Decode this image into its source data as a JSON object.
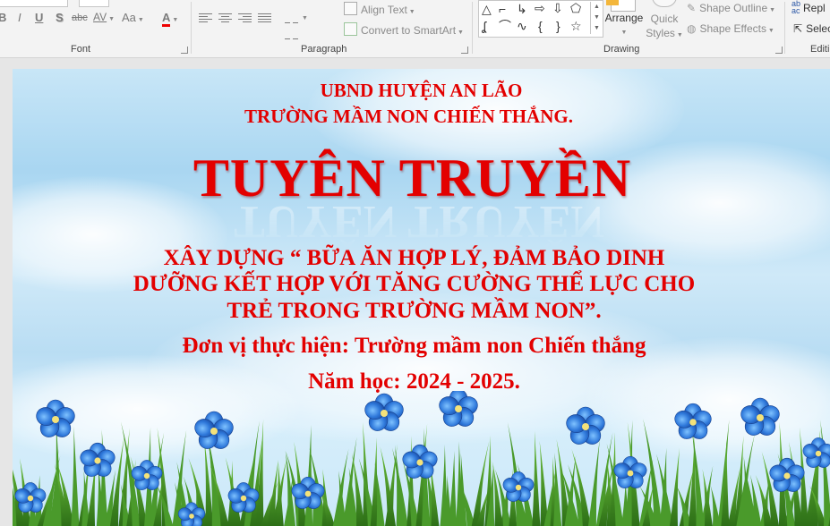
{
  "ribbon": {
    "font": {
      "label": "Font",
      "bold": "B",
      "italic": "I",
      "underline": "U",
      "shadow": "S",
      "strikethrough": "abc",
      "spacing": "AV",
      "change_case": "Aa",
      "font_color": "A"
    },
    "paragraph": {
      "label": "Paragraph",
      "align_text": "Align Text",
      "convert_smartart": "Convert to SmartArt"
    },
    "drawing": {
      "label": "Drawing",
      "arrange": "Arrange",
      "quick_styles_1": "Quick",
      "quick_styles_2": "Styles",
      "shape_outline": "Shape Outline",
      "shape_effects": "Shape Effects"
    },
    "editing": {
      "label": "Editi",
      "replace": "Repl",
      "select": "Selec"
    }
  },
  "slide": {
    "org_line1": "UBND HUYỆN AN LÃO",
    "org_line2": "TRƯỜNG MẦM NON CHIẾN THẮNG.",
    "headline": "TUYÊN TRUYỀN",
    "topic_line1": "XÂY DỰNG “ BỮA ĂN HỢP LÝ, ĐẢM BẢO DINH",
    "topic_line2": "DƯỠNG KẾT HỢP VỚI TĂNG CƯỜNG THỂ LỰC CHO",
    "topic_line3": "TRẺ TRONG TRƯỜNG MẦM NON”.",
    "unit": "Đơn vị thực hiện: Trường mầm non Chiến thắng",
    "school_year": "Năm học: 2024 - 2025."
  },
  "colors": {
    "title_red": "#e30000",
    "ribbon_bg": "#f3f3f3",
    "sky": "#b9ddf3",
    "grass": "#3f8f25",
    "flower": "#2a6fd6"
  },
  "icons": [
    "align-left-icon",
    "align-center-icon",
    "align-right-icon",
    "justify-icon",
    "columns-icon",
    "align-text-icon",
    "smartart-icon",
    "arrange-icon",
    "quick-styles-icon",
    "shape-outline-icon",
    "shape-effects-icon",
    "replace-icon",
    "select-icon"
  ]
}
